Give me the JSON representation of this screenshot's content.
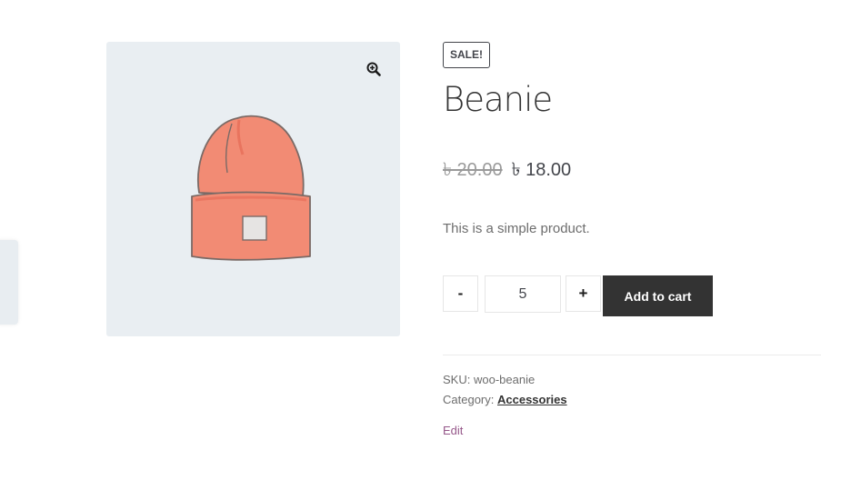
{
  "product": {
    "badge": "SALE!",
    "title": "Beanie",
    "price": {
      "regular": "৳ 20.00",
      "sale": "৳ 18.00"
    },
    "short_description": "This is a simple product.",
    "quantity": {
      "minus_label": "-",
      "value": "5",
      "plus_label": "+"
    },
    "add_to_cart_label": "Add to cart",
    "meta": {
      "sku_label": "SKU:",
      "sku_value": "woo-beanie",
      "category_label": "Category:",
      "category_value": "Accessories"
    },
    "edit_label": "Edit"
  },
  "gallery": {
    "zoom_icon": "zoom-in-icon",
    "image": "beanie"
  },
  "colors": {
    "accent_dark": "#333333",
    "gallery_bg": "#e9eef2",
    "beanie": "#f28b74",
    "edit_link": "#96588a"
  }
}
